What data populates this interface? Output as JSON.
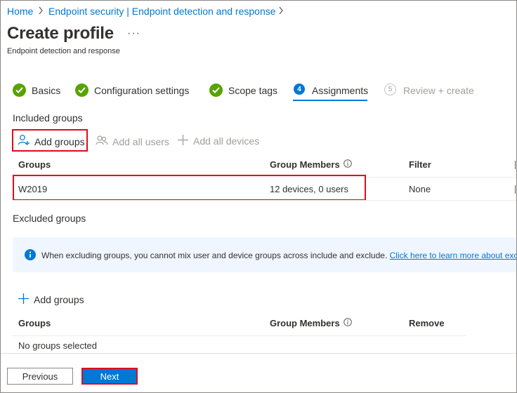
{
  "breadcrumb": {
    "items": [
      "Home",
      "Endpoint security | Endpoint detection and response"
    ]
  },
  "header": {
    "title": "Create profile",
    "more": "···",
    "subtitle": "Endpoint detection and response"
  },
  "wizard": {
    "steps": [
      {
        "label": "Basics",
        "status": "done"
      },
      {
        "label": "Configuration settings",
        "status": "done"
      },
      {
        "label": "Scope tags",
        "status": "done"
      },
      {
        "number": "4",
        "label": "Assignments",
        "status": "active"
      },
      {
        "number": "5",
        "label": "Review + create",
        "status": "pending"
      }
    ]
  },
  "included": {
    "label": "Included groups",
    "add_groups": "Add groups",
    "add_all_users": "Add all users",
    "add_all_devices": "Add all devices",
    "columns": [
      "Groups",
      "Group Members",
      "Filter"
    ],
    "rows": [
      {
        "group": "W2019",
        "members": "12 devices, 0 users",
        "filter": "None"
      }
    ]
  },
  "excluded": {
    "label": "Excluded groups",
    "info_text": "When excluding groups, you cannot mix user and device groups across include and exclude.",
    "info_link": "Click here to learn more about excl",
    "add_groups": "Add groups",
    "columns": [
      "Groups",
      "Group Members",
      "Remove"
    ],
    "empty_text": "No groups selected"
  },
  "footer": {
    "previous": "Previous",
    "next": "Next"
  },
  "colors": {
    "accent": "#0078d4",
    "success": "#57a300",
    "highlight": "#e00b1c"
  }
}
